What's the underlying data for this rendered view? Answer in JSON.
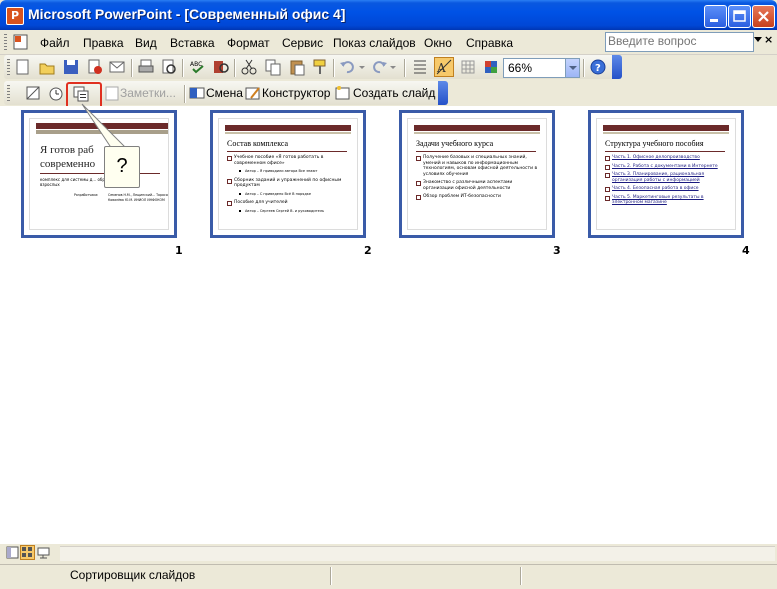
{
  "window": {
    "title": "Microsoft PowerPoint - [Современный офис 4]"
  },
  "menu": {
    "items": [
      "Файл",
      "Правка",
      "Вид",
      "Вставка",
      "Формат",
      "Сервис",
      "Показ слайдов",
      "Окно",
      "Справка"
    ],
    "help_placeholder": "Введите вопрос"
  },
  "toolbar_standard": {
    "zoom_value": "66%"
  },
  "toolbar_sorter": {
    "notes_label": "Заметки...",
    "transition_label": "Смена",
    "designer_label": "Конструктор",
    "new_slide_label": "Создать слайд"
  },
  "tooltip_callout": {
    "text": "?"
  },
  "slides": [
    {
      "number": "1",
      "title_line1": "Я готов раб",
      "title_line2": "современно",
      "subtitle": "комплекс для системы д... образования взрослых",
      "info_left": "Разработчики:",
      "info_right": "Семенов Н.М., Лещинский... Тарасов А.В., Ковалёва Ю.М. ИНИОЛ ИНФОКОМ"
    },
    {
      "number": "2",
      "title": "Состав комплекса",
      "bullets": [
        {
          "text": "Учебное пособие «Я готов работать в современном офисе»",
          "sub": false
        },
        {
          "text": "Автор – Я приводили автора Все знают",
          "sub": true
        },
        {
          "text": "Сборник заданий и упражнений по офисным продуктам",
          "sub": false
        },
        {
          "text": "Автор – С приведено Всё В порядке",
          "sub": true
        },
        {
          "text": "Пособие для учителей",
          "sub": false
        },
        {
          "text": "Автор – Сергеев Сергей В. и руководитель",
          "sub": true
        }
      ]
    },
    {
      "number": "3",
      "title": "Задачи учебного курса",
      "bullets": [
        {
          "text": "Получение базовых и специальных знаний, умений и навыков по информационным технологиям, основам офисной деятельности в условиях обучения",
          "sub": false
        },
        {
          "text": "Знакомство с различными аспектами организации офисной деятельности",
          "sub": false
        },
        {
          "text": "Обзор проблем ИТ-безопасности",
          "sub": false
        }
      ]
    },
    {
      "number": "4",
      "title": "Структура учебного пособия",
      "bullets": [
        {
          "text": "Часть 1. Офисное делопроизводство",
          "sub": false
        },
        {
          "text": "Часть 2. Работа с документами в Интернете",
          "sub": false
        },
        {
          "text": "Часть 3. Планирование, рациональная организация работы с информацией",
          "sub": false
        },
        {
          "text": "Часть 4. Безопасная работа в офисе",
          "sub": false
        },
        {
          "text": "Часть 5. Маркетинговые результаты в электронном магазине",
          "sub": false
        }
      ]
    }
  ],
  "status": {
    "view_name": "Сортировщик слайдов"
  },
  "colors": {
    "title_bar": "#0052e6",
    "slide_accent": "#6b2a2a",
    "selection_border": "#3a5ba8",
    "highlight_red": "#e03020"
  }
}
